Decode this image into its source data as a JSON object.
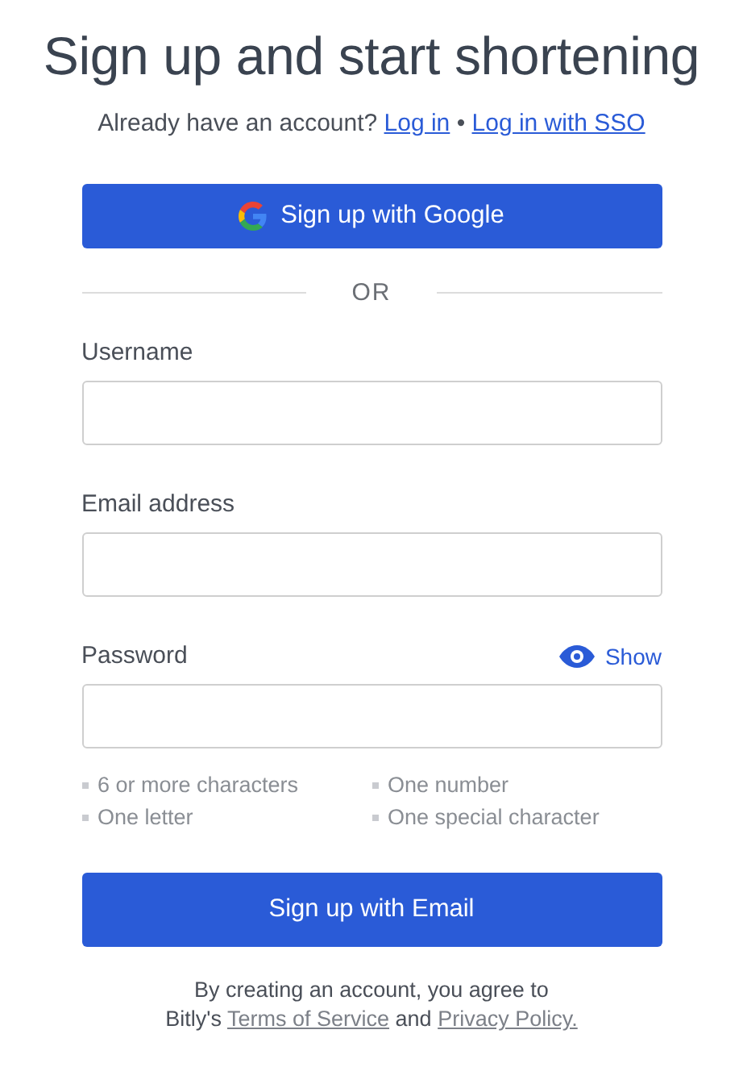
{
  "title": "Sign up and start shortening",
  "login_prompt": {
    "text": "Already have an account?",
    "links": [
      "Log in",
      "Log in with SSO"
    ],
    "separator": "•"
  },
  "google_button": {
    "label": "Sign up with Google"
  },
  "divider": "OR",
  "fields": [
    {
      "label": "Username"
    },
    {
      "label": "Email address"
    },
    {
      "label": "Password",
      "toggle": "Show"
    }
  ],
  "requirements": [
    "6 or more characters",
    "One number",
    "One letter",
    "One special character"
  ],
  "submit_button": {
    "label": "Sign up with Email"
  },
  "agreement": {
    "line_1": "By creating an account, you agree to",
    "prefix": "Bitly's",
    "terms": "Terms of Service",
    "joiner": "and",
    "privacy": "Privacy Policy."
  }
}
